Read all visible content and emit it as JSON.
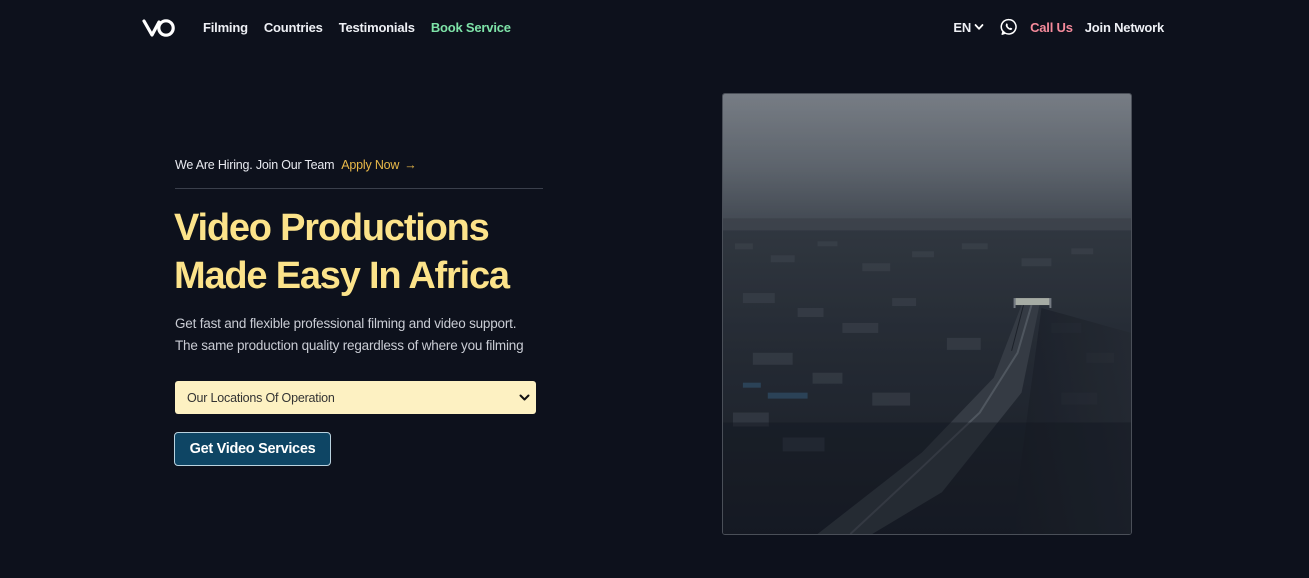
{
  "nav": {
    "logo": "VO",
    "links": [
      "Filming",
      "Countries",
      "Testimonials",
      "Book Service"
    ],
    "lang": "EN",
    "call": "Call Us",
    "join": "Join Network",
    "colors": {
      "accent_green": "#7ee3a8",
      "call_pink": "#f58a9b"
    }
  },
  "hero": {
    "hiring_text": "We Are Hiring. Join Our Team",
    "apply_label": "Apply Now",
    "apply_arrow": "→",
    "headline_line1": "Video Productions",
    "headline_line2": "Made Easy In Africa",
    "sub_line1": "Get fast and flexible professional filming and video support.",
    "sub_line2": "The same production quality regardless of where you filming",
    "select_value": "Our Locations Of Operation",
    "cta_label": "Get Video Services"
  },
  "colors": {
    "background": "#0d111c",
    "headline": "#fce38a",
    "apply": "#e9b949",
    "cta_bg": "#0e4564",
    "select_bg": "#fdf1c2"
  }
}
